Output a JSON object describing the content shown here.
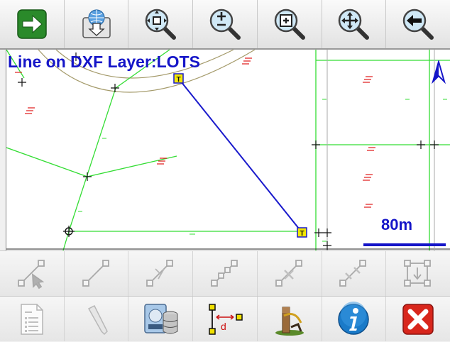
{
  "map": {
    "title": "Line on DXF Layer:LOTS",
    "scale_label": "80m",
    "marker_label": "T",
    "marker_label_2": "T"
  },
  "toolbar": [
    {
      "icon": "next-arrow-icon"
    },
    {
      "icon": "download-globe-icon"
    },
    {
      "icon": "zoom-extents-icon"
    },
    {
      "icon": "zoom-in-out-icon"
    },
    {
      "icon": "zoom-window-icon"
    },
    {
      "icon": "pan-icon"
    },
    {
      "icon": "back-arrow-icon"
    }
  ],
  "bottom_row_1": [
    {
      "icon": "select-line-icon"
    },
    {
      "icon": "draw-line-icon"
    },
    {
      "icon": "edit-line-icon"
    },
    {
      "icon": "polyline-icon"
    },
    {
      "icon": "delete-vertex-icon"
    },
    {
      "icon": "split-line-icon"
    },
    {
      "icon": "move-polygon-icon"
    }
  ],
  "bottom_row_2": [
    {
      "icon": "list-document-icon"
    },
    {
      "icon": "pencil-icon"
    },
    {
      "icon": "database-save-icon"
    },
    {
      "icon": "distance-icon",
      "label": "d"
    },
    {
      "icon": "stakeout-icon"
    },
    {
      "icon": "info-icon"
    },
    {
      "icon": "close-icon"
    }
  ],
  "colors": {
    "title": "#1515c8",
    "selected_line": "#1a1acc",
    "lot_lines": "#33dd33",
    "circle": "#a49a6a",
    "close": "#d8261c"
  }
}
